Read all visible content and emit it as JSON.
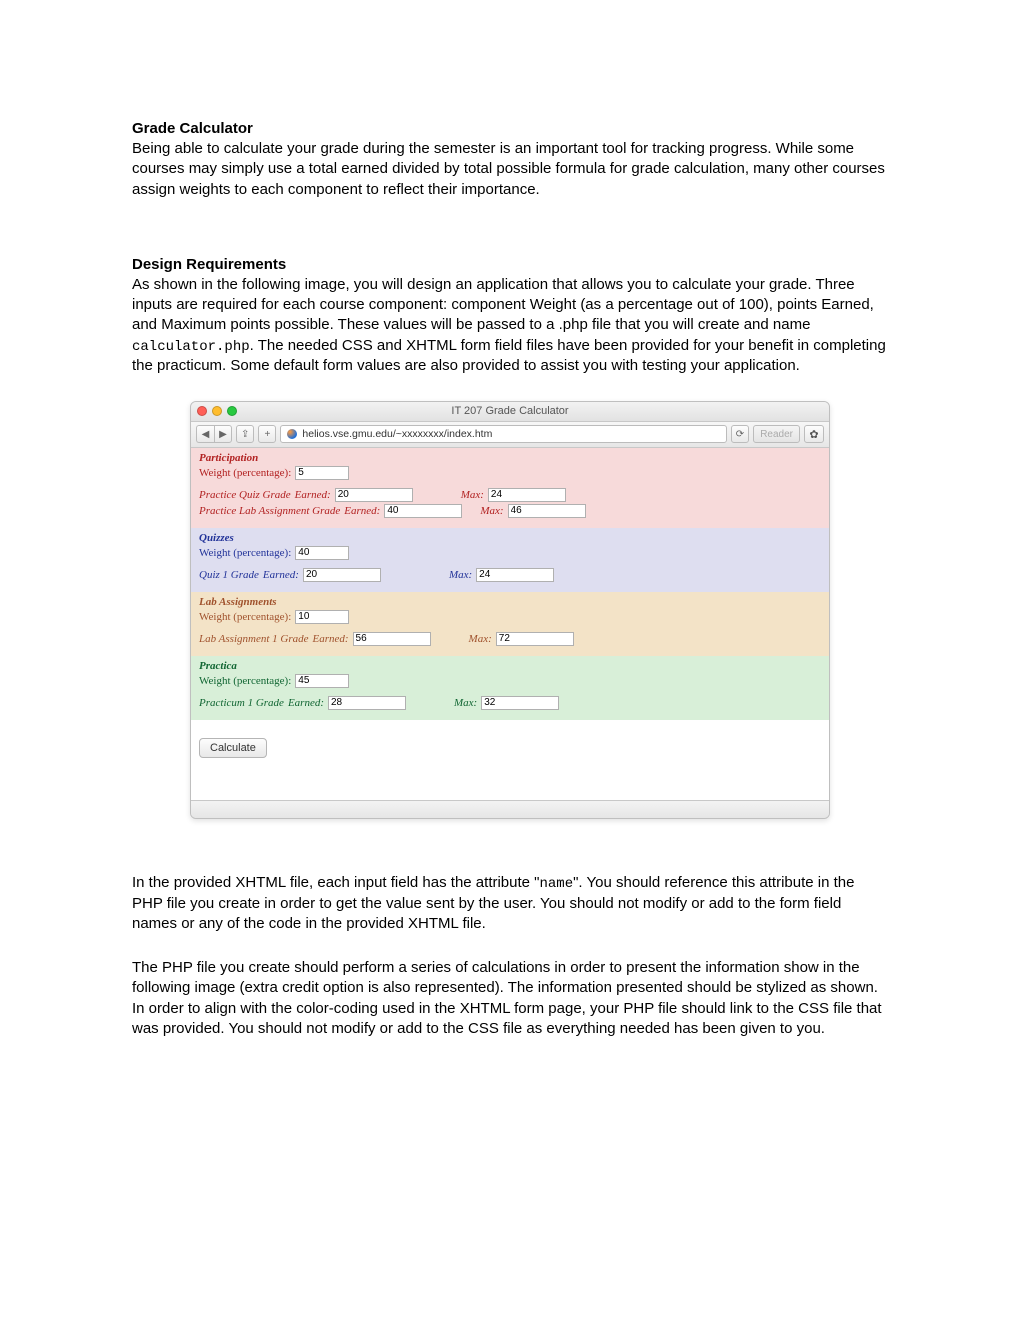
{
  "doc": {
    "h1": "Grade Calculator",
    "p1": "Being able to calculate your grade during the semester is an important tool for tracking progress.  While some courses may simply use a total earned divided by total possible formula for grade calculation, many other courses assign weights to each component to reflect their importance.",
    "h2": "Design Requirements",
    "p2a": "As shown in the following image, you will design an application that allows you to calculate your grade.  Three inputs are required for each course component: component Weight (as a percentage out of 100), points Earned, and Maximum points possible.  These values will be passed to a .php file that you will create and name ",
    "p2_code": "calculator.php",
    "p2b": ".  The needed CSS and XHTML form field files have been provided for your benefit in completing the practicum.  Some default form values are also provided to assist you with testing your application.",
    "p3a": "In the provided XHTML file, each input field has the attribute \"",
    "p3_code": "name",
    "p3b": "\".  You should reference this attribute in the PHP file you create in order to get the value sent by the user. You should not modify or add to the form field names or any of the code in the provided XHTML file.",
    "p4": "The PHP file you create should perform a series of calculations in order to present the information show in the following image (extra credit option is also represented).  The information presented should be stylized as shown. In order to align with the color-coding used in the XHTML form page, your PHP file should link to the CSS file that was provided.  You should not modify or add to the CSS file as everything needed has been given to you."
  },
  "window": {
    "title": "IT 207 Grade Calculator",
    "url": "helios.vse.gmu.edu/~xxxxxxxx/index.htm",
    "refresh_glyph": "⟳",
    "reader_label": "Reader",
    "gear_glyph": "✿",
    "back_glyph": "◀",
    "fwd_glyph": "▶",
    "share_glyph": "⇪",
    "plus_glyph": "+"
  },
  "labels": {
    "weight": "Weight (percentage):",
    "earned_suffix": " Earned:",
    "max": "Max:",
    "calculate": "Calculate"
  },
  "sections": {
    "participation": {
      "title": "Participation",
      "weight": "5",
      "items": [
        {
          "name": "Practice Quiz Grade",
          "earned": "20",
          "max": "24"
        },
        {
          "name": "Practice Lab Assignment Grade",
          "earned": "40",
          "max": "46"
        }
      ]
    },
    "quizzes": {
      "title": "Quizzes",
      "weight": "40",
      "items": [
        {
          "name": "Quiz 1 Grade",
          "earned": "20",
          "max": "24"
        }
      ]
    },
    "labs": {
      "title": "Lab Assignments",
      "weight": "10",
      "items": [
        {
          "name": "Lab Assignment 1 Grade",
          "earned": "56",
          "max": "72"
        }
      ]
    },
    "practica": {
      "title": "Practica",
      "weight": "45",
      "items": [
        {
          "name": "Practicum 1 Grade",
          "earned": "28",
          "max": "32"
        }
      ]
    }
  }
}
